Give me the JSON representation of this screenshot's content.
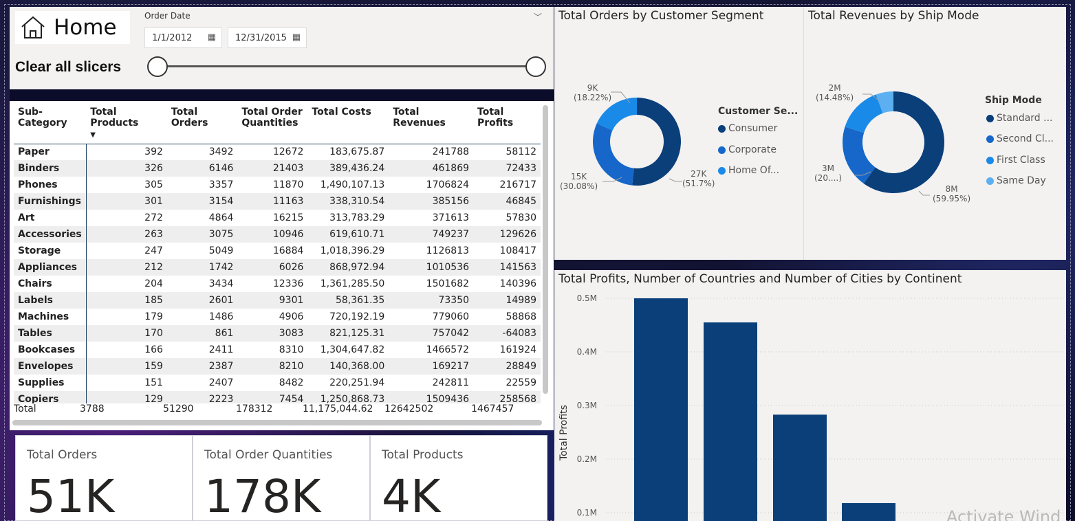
{
  "header": {
    "home_label": "Home",
    "clear_slicers": "Clear all slicers",
    "slicer_title": "Order Date",
    "date_start": "1/1/2012",
    "date_end": "12/31/2015"
  },
  "table": {
    "columns": [
      "Sub-Category",
      "Total Products",
      "Total Orders",
      "Total Order Quantities",
      "Total Costs",
      "Total Revenues",
      "Total Profits"
    ],
    "sort_indicator": "▼",
    "rows": [
      [
        "Paper",
        "392",
        "3492",
        "12672",
        "183,675.87",
        "241788",
        "58112"
      ],
      [
        "Binders",
        "326",
        "6146",
        "21403",
        "389,436.24",
        "461869",
        "72433"
      ],
      [
        "Phones",
        "305",
        "3357",
        "11870",
        "1,490,107.13",
        "1706824",
        "216717"
      ],
      [
        "Furnishings",
        "301",
        "3154",
        "11163",
        "338,310.54",
        "385156",
        "46845"
      ],
      [
        "Art",
        "272",
        "4864",
        "16215",
        "313,783.29",
        "371613",
        "57830"
      ],
      [
        "Accessories",
        "263",
        "3075",
        "10946",
        "619,610.71",
        "749237",
        "129626"
      ],
      [
        "Storage",
        "247",
        "5049",
        "16884",
        "1,018,396.29",
        "1126813",
        "108417"
      ],
      [
        "Appliances",
        "212",
        "1742",
        "6026",
        "868,972.94",
        "1010536",
        "141563"
      ],
      [
        "Chairs",
        "204",
        "3434",
        "12336",
        "1,361,285.50",
        "1501682",
        "140396"
      ],
      [
        "Labels",
        "185",
        "2601",
        "9301",
        "58,361.35",
        "73350",
        "14989"
      ],
      [
        "Machines",
        "179",
        "1486",
        "4906",
        "720,192.19",
        "779060",
        "58868"
      ],
      [
        "Tables",
        "170",
        "861",
        "3083",
        "821,125.31",
        "757042",
        "-64083"
      ],
      [
        "Bookcases",
        "166",
        "2411",
        "8310",
        "1,304,647.82",
        "1466572",
        "161924"
      ],
      [
        "Envelopes",
        "159",
        "2387",
        "8210",
        "140,368.00",
        "169217",
        "28849"
      ],
      [
        "Supplies",
        "151",
        "2407",
        "8482",
        "220,251.94",
        "242811",
        "22559"
      ],
      [
        "Copiers",
        "129",
        "2223",
        "7454",
        "1,250,868.73",
        "1509436",
        "258568"
      ]
    ],
    "total": [
      "Total",
      "3788",
      "51290",
      "178312",
      "11,175,044.62",
      "12642502",
      "1467457"
    ]
  },
  "kpis": [
    {
      "label": "Total Orders",
      "value": "51K"
    },
    {
      "label": "Total Order Quantities",
      "value": "178K"
    },
    {
      "label": "Total Products",
      "value": "4K"
    }
  ],
  "segment_chart": {
    "title": "Total Orders by Customer Segment",
    "legend_title": "Customer Se...",
    "legend": [
      "Consumer",
      "Corporate",
      "Home Of..."
    ],
    "labels": [
      {
        "value": "27K",
        "pct": "(51.7%)"
      },
      {
        "value": "15K",
        "pct": "(30.08%)"
      },
      {
        "value": "9K",
        "pct": "(18.22%)"
      }
    ]
  },
  "shipmode_chart": {
    "title": "Total Revenues by Ship Mode",
    "legend_title": "Ship Mode",
    "legend": [
      "Standard ...",
      "Second Cl...",
      "First Class",
      "Same Day"
    ],
    "labels": [
      {
        "value": "8M",
        "pct": "(59.95%)"
      },
      {
        "value": "3M",
        "pct": "(20....)"
      },
      {
        "value": "2M",
        "pct": "(14.48%)"
      }
    ]
  },
  "bar_chart": {
    "title": "Total Profits, Number of Countries and Number of Cities by Continent",
    "ylabel": "Total Profits"
  },
  "colors": {
    "dark_blue": "#0b3f7a",
    "mid_blue": "#1667c9",
    "light_blue": "#1a8ae8",
    "pale_blue": "#5cb0f2",
    "total_blue": "#1a6fd6"
  },
  "watermark": "Activate Wind",
  "chart_data": [
    {
      "type": "pie",
      "title": "Total Orders by Customer Segment",
      "labels": [
        "Consumer",
        "Corporate",
        "Home Of..."
      ],
      "values": [
        27000,
        15000,
        9000
      ],
      "percent": [
        51.7,
        30.08,
        18.22
      ]
    },
    {
      "type": "pie",
      "title": "Total Revenues by Ship Mode",
      "labels": [
        "Standard ...",
        "Second Cl...",
        "First Class",
        "Same Day"
      ],
      "values": [
        8000000,
        3000000,
        2000000,
        400000
      ],
      "percent": [
        59.95,
        20.0,
        14.48,
        5.57
      ]
    },
    {
      "type": "bar",
      "title": "Total Profits, Number of Countries and Number of Cities by Continent",
      "ylabel": "Total Profits",
      "yticks": [
        "0.1M",
        "0.2M",
        "0.3M",
        "0.4M",
        "0.5M"
      ],
      "ylim": [
        0,
        0.5
      ],
      "values": [
        0.5,
        0.455,
        0.283,
        0.118
      ]
    }
  ]
}
